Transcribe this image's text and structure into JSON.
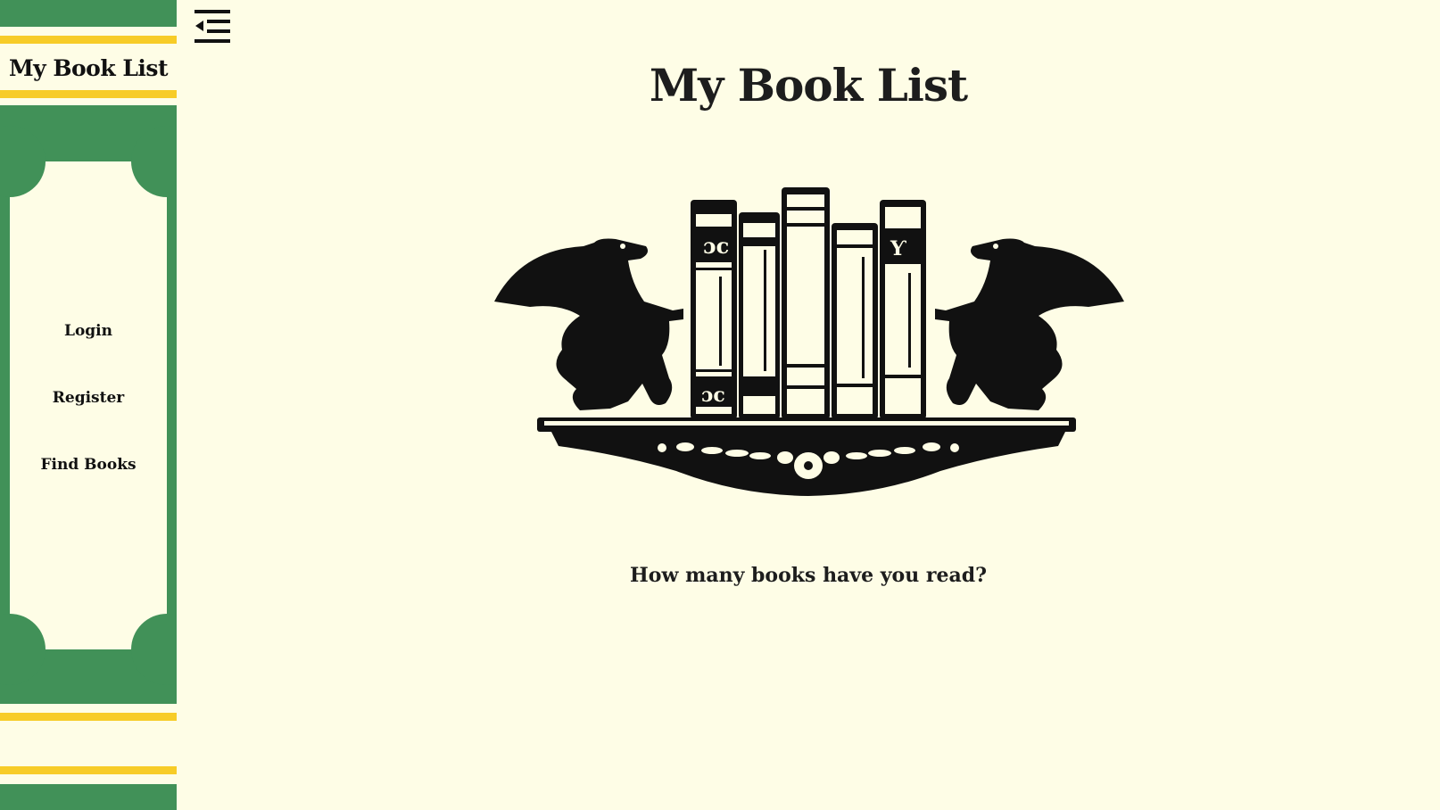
{
  "sidebar": {
    "brand": "My Book List",
    "nav": [
      {
        "label": "Login"
      },
      {
        "label": "Register"
      },
      {
        "label": "Find Books"
      }
    ]
  },
  "header": {
    "menu_icon": "menu-collapse-icon"
  },
  "main": {
    "title": "My Book List",
    "hero_image": "bookshelf-griffins-illustration",
    "question": "How many books have you read?"
  },
  "colors": {
    "background": "#fefde6",
    "spine_green": "#419158",
    "stripe_yellow": "#f7cc28",
    "text": "#1d1d1d"
  }
}
